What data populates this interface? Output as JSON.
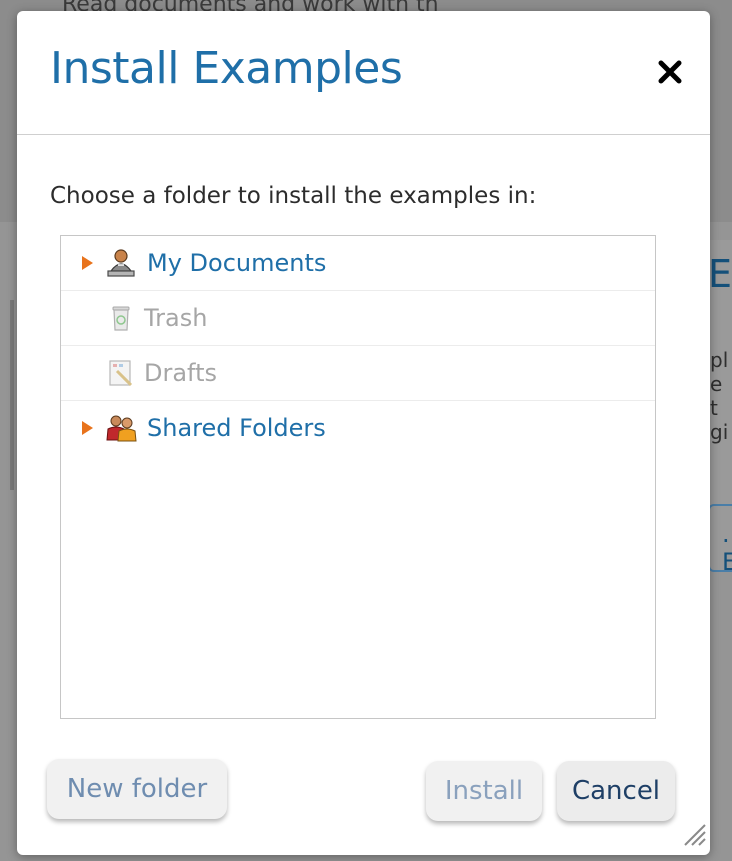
{
  "background": {
    "top_text": "Read documents and work with th",
    "heading_fragment": "E",
    "para_lines": [
      "pl",
      "e t",
      "gi"
    ],
    "button_fragment": ". E"
  },
  "dialog": {
    "title": "Install Examples",
    "close_glyph": "✕",
    "instruction": "Choose a folder to install the examples in:",
    "folders": [
      {
        "label": "My Documents",
        "icon": "user-documents-icon",
        "expandable": true,
        "state": "active"
      },
      {
        "label": "Trash",
        "icon": "trash-icon",
        "expandable": false,
        "state": "disabled"
      },
      {
        "label": "Drafts",
        "icon": "drafts-icon",
        "expandable": false,
        "state": "disabled"
      },
      {
        "label": "Shared Folders",
        "icon": "shared-folders-icon",
        "expandable": true,
        "state": "active"
      }
    ],
    "buttons": {
      "new_folder": "New folder",
      "install": "Install",
      "cancel": "Cancel"
    }
  },
  "colors": {
    "title": "#1f6fa8",
    "link": "#1f6fa8",
    "disabled": "#a6a6a6",
    "expander": "#e8731c",
    "cancel_text": "#1e3f66"
  }
}
